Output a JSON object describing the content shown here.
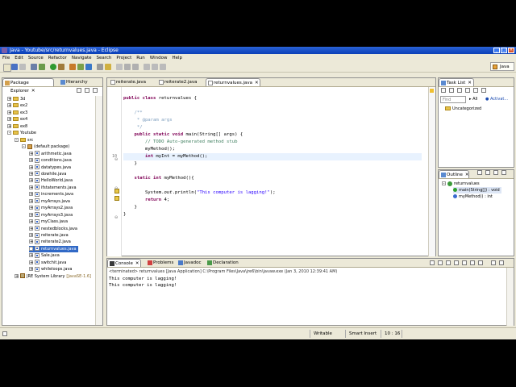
{
  "window": {
    "title": "Java - Youtube/src/returnvalues.java - Eclipse"
  },
  "menu": [
    "File",
    "Edit",
    "Source",
    "Refactor",
    "Navigate",
    "Search",
    "Project",
    "Run",
    "Window",
    "Help"
  ],
  "perspective": {
    "label": "Java"
  },
  "package_explorer": {
    "tabs": [
      "Package Explorer",
      "Hierarchy"
    ],
    "rows": [
      {
        "label": "3d",
        "indent": 0,
        "exp": "+",
        "icon": "folder"
      },
      {
        "label": "ex2",
        "indent": 0,
        "exp": "+",
        "icon": "folder"
      },
      {
        "label": "ex3",
        "indent": 0,
        "exp": "+",
        "icon": "folder"
      },
      {
        "label": "ex4",
        "indent": 0,
        "exp": "+",
        "icon": "folder"
      },
      {
        "label": "ex8",
        "indent": 0,
        "exp": "+",
        "icon": "folder"
      },
      {
        "label": "Youtube",
        "indent": 0,
        "exp": "-",
        "icon": "folder"
      },
      {
        "label": "src",
        "indent": 1,
        "exp": "-",
        "icon": "folder"
      },
      {
        "label": "(default package)",
        "indent": 2,
        "exp": "-",
        "icon": "package"
      },
      {
        "label": "arithmetic.java",
        "indent": 3,
        "exp": "+",
        "icon": "java"
      },
      {
        "label": "conditions.java",
        "indent": 3,
        "exp": "+",
        "icon": "java"
      },
      {
        "label": "datatypes.java",
        "indent": 3,
        "exp": "+",
        "icon": "java"
      },
      {
        "label": "dowhile.java",
        "indent": 3,
        "exp": "+",
        "icon": "java"
      },
      {
        "label": "HelloWorld.java",
        "indent": 3,
        "exp": "+",
        "icon": "java"
      },
      {
        "label": "ifstatements.java",
        "indent": 3,
        "exp": "+",
        "icon": "java"
      },
      {
        "label": "increments.java",
        "indent": 3,
        "exp": "+",
        "icon": "java"
      },
      {
        "label": "myArrays.java",
        "indent": 3,
        "exp": "+",
        "icon": "java"
      },
      {
        "label": "myArrays2.java",
        "indent": 3,
        "exp": "+",
        "icon": "java"
      },
      {
        "label": "myArrays3.java",
        "indent": 3,
        "exp": "+",
        "icon": "java"
      },
      {
        "label": "myClass.java",
        "indent": 3,
        "exp": "+",
        "icon": "java"
      },
      {
        "label": "nestedblocks.java",
        "indent": 3,
        "exp": "+",
        "icon": "java"
      },
      {
        "label": "reiterate.java",
        "indent": 3,
        "exp": "+",
        "icon": "java"
      },
      {
        "label": "reiterate2.java",
        "indent": 3,
        "exp": "+",
        "icon": "java"
      },
      {
        "label": "returnvalues.java",
        "indent": 3,
        "exp": "+",
        "icon": "java",
        "selected": true
      },
      {
        "label": "Sale.java",
        "indent": 3,
        "exp": "+",
        "icon": "java"
      },
      {
        "label": "switchit.java",
        "indent": 3,
        "exp": "+",
        "icon": "java"
      },
      {
        "label": "whileloops.java",
        "indent": 3,
        "exp": "+",
        "icon": "java"
      },
      {
        "label": "JRE System Library",
        "suffix": "[JavaSE-1.6]",
        "indent": 1,
        "exp": "+",
        "icon": "library"
      }
    ]
  },
  "editor": {
    "tabs": [
      "reiterate.java",
      "reiterate2.java",
      "returnvalues.java"
    ],
    "lines": [
      {
        "n": "",
        "html": ""
      },
      {
        "n": "",
        "html": "<span class='kw'>public class</span> returnvalues {"
      },
      {
        "n": "",
        "html": ""
      },
      {
        "n": "",
        "html": "    <span class='dj'>/**</span>"
      },
      {
        "n": "",
        "html": "<span class='dj'>     * @param args</span>"
      },
      {
        "n": "",
        "html": "<span class='dj'>     */</span>"
      },
      {
        "n": "",
        "html": "    <span class='kw'>public static void</span> main(String[] args) {"
      },
      {
        "n": "",
        "html": "        <span class='cm'>// TODO Auto-generated method stub</span>"
      },
      {
        "n": "",
        "html": "        myMethod();"
      },
      {
        "n": "10",
        "html": "        <span class='kw'>int</span> myInt = myMethod();"
      },
      {
        "n": "",
        "html": "    }"
      },
      {
        "n": "",
        "html": ""
      },
      {
        "n": "",
        "html": "    <span class='kw'>static int</span> myMethod(){"
      },
      {
        "n": "",
        "html": ""
      },
      {
        "n": "",
        "html": "        System.<i>out</i>.println(<span class='str'>\"This computer is lagging!\"</span>);"
      },
      {
        "n": "",
        "html": "        <span class='kw'>return</span> 4;"
      },
      {
        "n": "",
        "html": "    }"
      },
      {
        "n": "",
        "html": "}"
      }
    ]
  },
  "task_list": {
    "tab": "Task List",
    "find_placeholder": "Find",
    "all_label": "All",
    "activate_label": "Activat...",
    "category": "Uncategorized"
  },
  "outline": {
    "tab": "Outline",
    "class_name": "returnvalues",
    "members": [
      "main(String[]) : void",
      "myMethod() : int"
    ]
  },
  "console": {
    "tabs": [
      "Console",
      "Problems",
      "Javadoc",
      "Declaration"
    ],
    "header": "<terminated> returnvalues [Java Application] C:\\Program Files\\Java\\jre6\\bin\\javaw.exe (Jan 3, 2010 12:39:41 AM)",
    "output": [
      "This computer is lagging!",
      "This computer is lagging!"
    ]
  },
  "status": {
    "writable": "Writable",
    "insert": "Smart Insert",
    "position": "10 : 16"
  }
}
